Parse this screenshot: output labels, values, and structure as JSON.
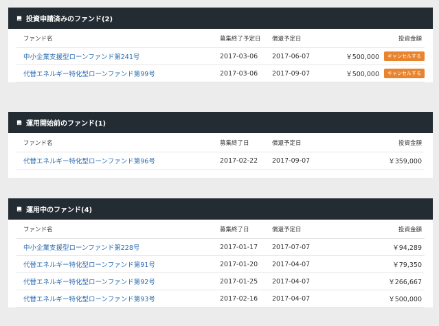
{
  "panels": [
    {
      "title": "投資申請済みのファンド(2)",
      "columns": [
        "ファンド名",
        "募集終了予定日",
        "償還予定日",
        "投資金額"
      ],
      "rows": [
        {
          "name": "中小企業支援型ローンファンド第241号",
          "date1": "2017-03-06",
          "date2": "2017-06-07",
          "amount": "￥500,000",
          "action": "キャンセルする"
        },
        {
          "name": "代替エネルギー特化型ローンファンド第99号",
          "date1": "2017-03-06",
          "date2": "2017-09-07",
          "amount": "￥500,000",
          "action": "キャンセルする"
        }
      ]
    },
    {
      "title": "運用開始前のファンド(1)",
      "columns": [
        "ファンド名",
        "募集終了日",
        "償還予定日",
        "投資金額"
      ],
      "rows": [
        {
          "name": "代替エネルギー特化型ローンファンド第96号",
          "date1": "2017-02-22",
          "date2": "2017-09-07",
          "amount": "￥359,000"
        }
      ]
    },
    {
      "title": "運用中のファンド(4)",
      "columns": [
        "ファンド名",
        "募集終了日",
        "償還予定日",
        "投資金額"
      ],
      "rows": [
        {
          "name": "中小企業支援型ローンファンド第228号",
          "date1": "2017-01-17",
          "date2": "2017-07-07",
          "amount": "￥94,289"
        },
        {
          "name": "代替エネルギー特化型ローンファンド第91号",
          "date1": "2017-01-20",
          "date2": "2017-04-07",
          "amount": "￥79,350"
        },
        {
          "name": "代替エネルギー特化型ローンファンド第92号",
          "date1": "2017-01-25",
          "date2": "2017-04-07",
          "amount": "￥266,667"
        },
        {
          "name": "代替エネルギー特化型ローンファンド第93号",
          "date1": "2017-02-16",
          "date2": "2017-04-07",
          "amount": "￥500,000"
        }
      ]
    }
  ],
  "colors": {
    "header_bg": "#232b33",
    "link": "#2a6bb0",
    "cancel_button": "#e8832e",
    "page_bg": "#ececec"
  },
  "icons": {
    "panel_header": "book-icon"
  }
}
